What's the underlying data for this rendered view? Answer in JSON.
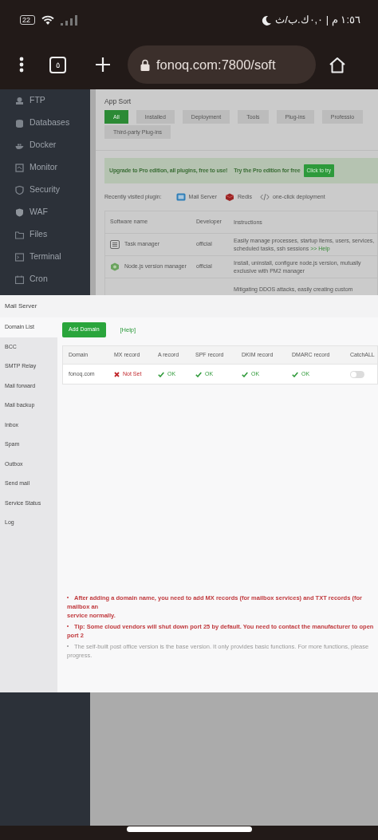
{
  "status_bar": {
    "battery": "22",
    "time": "١:٥٦ م | ٠,٠ك.ب/ث"
  },
  "browser": {
    "tab_count": "٥",
    "url": "fonoq.com:7800/soft"
  },
  "sidebar": {
    "items": [
      {
        "label": "FTP"
      },
      {
        "label": "Databases"
      },
      {
        "label": "Docker"
      },
      {
        "label": "Monitor"
      },
      {
        "label": "Security"
      },
      {
        "label": "WAF"
      },
      {
        "label": "Files"
      },
      {
        "label": "Terminal"
      },
      {
        "label": "Cron"
      }
    ]
  },
  "app_sort": {
    "title": "App Sort",
    "tabs": [
      {
        "label": "All",
        "selected": true
      },
      {
        "label": "Installed",
        "selected": false
      },
      {
        "label": "Deployment",
        "selected": false
      },
      {
        "label": "Tools",
        "selected": false
      },
      {
        "label": "Plug-ins",
        "selected": false
      },
      {
        "label": "Professio",
        "selected": false
      },
      {
        "label": "Third-party Plug-ins",
        "selected": false
      }
    ]
  },
  "banner": {
    "message": "Upgrade to Pro edition, all plugins, free to use!",
    "offer": "Try the Pro edition for free",
    "button": "Click to try"
  },
  "recent": {
    "label": "Recently visited plugin:",
    "plugins": [
      {
        "label": "Mail Server",
        "kind": "mail"
      },
      {
        "label": "Redis",
        "kind": "redis"
      },
      {
        "label": "one-click deployment",
        "kind": "code"
      }
    ]
  },
  "software_table": {
    "columns": [
      "Software name",
      "Developer",
      "Instructions"
    ],
    "rows": [
      {
        "name": "Task manager",
        "developer": "official",
        "instructions": "Easily manage processes, startup items, users, services, scheduled tasks, ssh sessions",
        "link": ">> Help",
        "kind": "task"
      },
      {
        "name": "Node.js version manager",
        "developer": "official",
        "instructions": "Install, uninstall, configure node.js version, mutually exclusive with PM2 manager",
        "kind": "node"
      },
      {
        "instructions": "Mitigating DDOS attacks, easily creating custom"
      }
    ]
  },
  "modal": {
    "title": "Mail Server",
    "nav": [
      {
        "label": "Domain List",
        "selected": true
      },
      {
        "label": "BCC",
        "selected": false
      },
      {
        "label": "SMTP Relay",
        "selected": false
      },
      {
        "label": "Mail forward",
        "selected": false
      },
      {
        "label": "Mail backup",
        "selected": false
      },
      {
        "label": "Inbox",
        "selected": false
      },
      {
        "label": "Spam",
        "selected": false
      },
      {
        "label": "Outbox",
        "selected": false
      },
      {
        "label": "Send mail",
        "selected": false
      },
      {
        "label": "Service Status",
        "selected": false
      },
      {
        "label": "Log",
        "selected": false
      }
    ],
    "add_button": "Add Domain",
    "help": "[Help]",
    "columns": [
      "Domain",
      "MX record",
      "A record",
      "SPF record",
      "DKIM record",
      "DMARC record",
      "CatchALL"
    ],
    "rows": [
      {
        "domain": "fonoq.com",
        "records": [
          {
            "kind": "error",
            "text": "Not Set"
          },
          {
            "kind": "ok",
            "text": "OK"
          },
          {
            "kind": "ok",
            "text": "OK"
          },
          {
            "kind": "ok",
            "text": "OK"
          },
          {
            "kind": "ok",
            "text": "OK"
          }
        ],
        "catchall": false
      }
    ],
    "notes": [
      {
        "kind": "warning",
        "lines": [
          "After adding a domain name, you need to add MX records (for mailbox services) and TXT records (for mailbox an",
          "service normally."
        ]
      },
      {
        "kind": "warning",
        "lines": [
          "Tip: Some cloud vendors will shut down port 25 by default. You need to contact the manufacturer to open port 2"
        ]
      },
      {
        "kind": "info",
        "lines": [
          "The self-built post office version is the base version. It only provides basic functions. For more functions, please",
          "progress."
        ]
      }
    ]
  }
}
